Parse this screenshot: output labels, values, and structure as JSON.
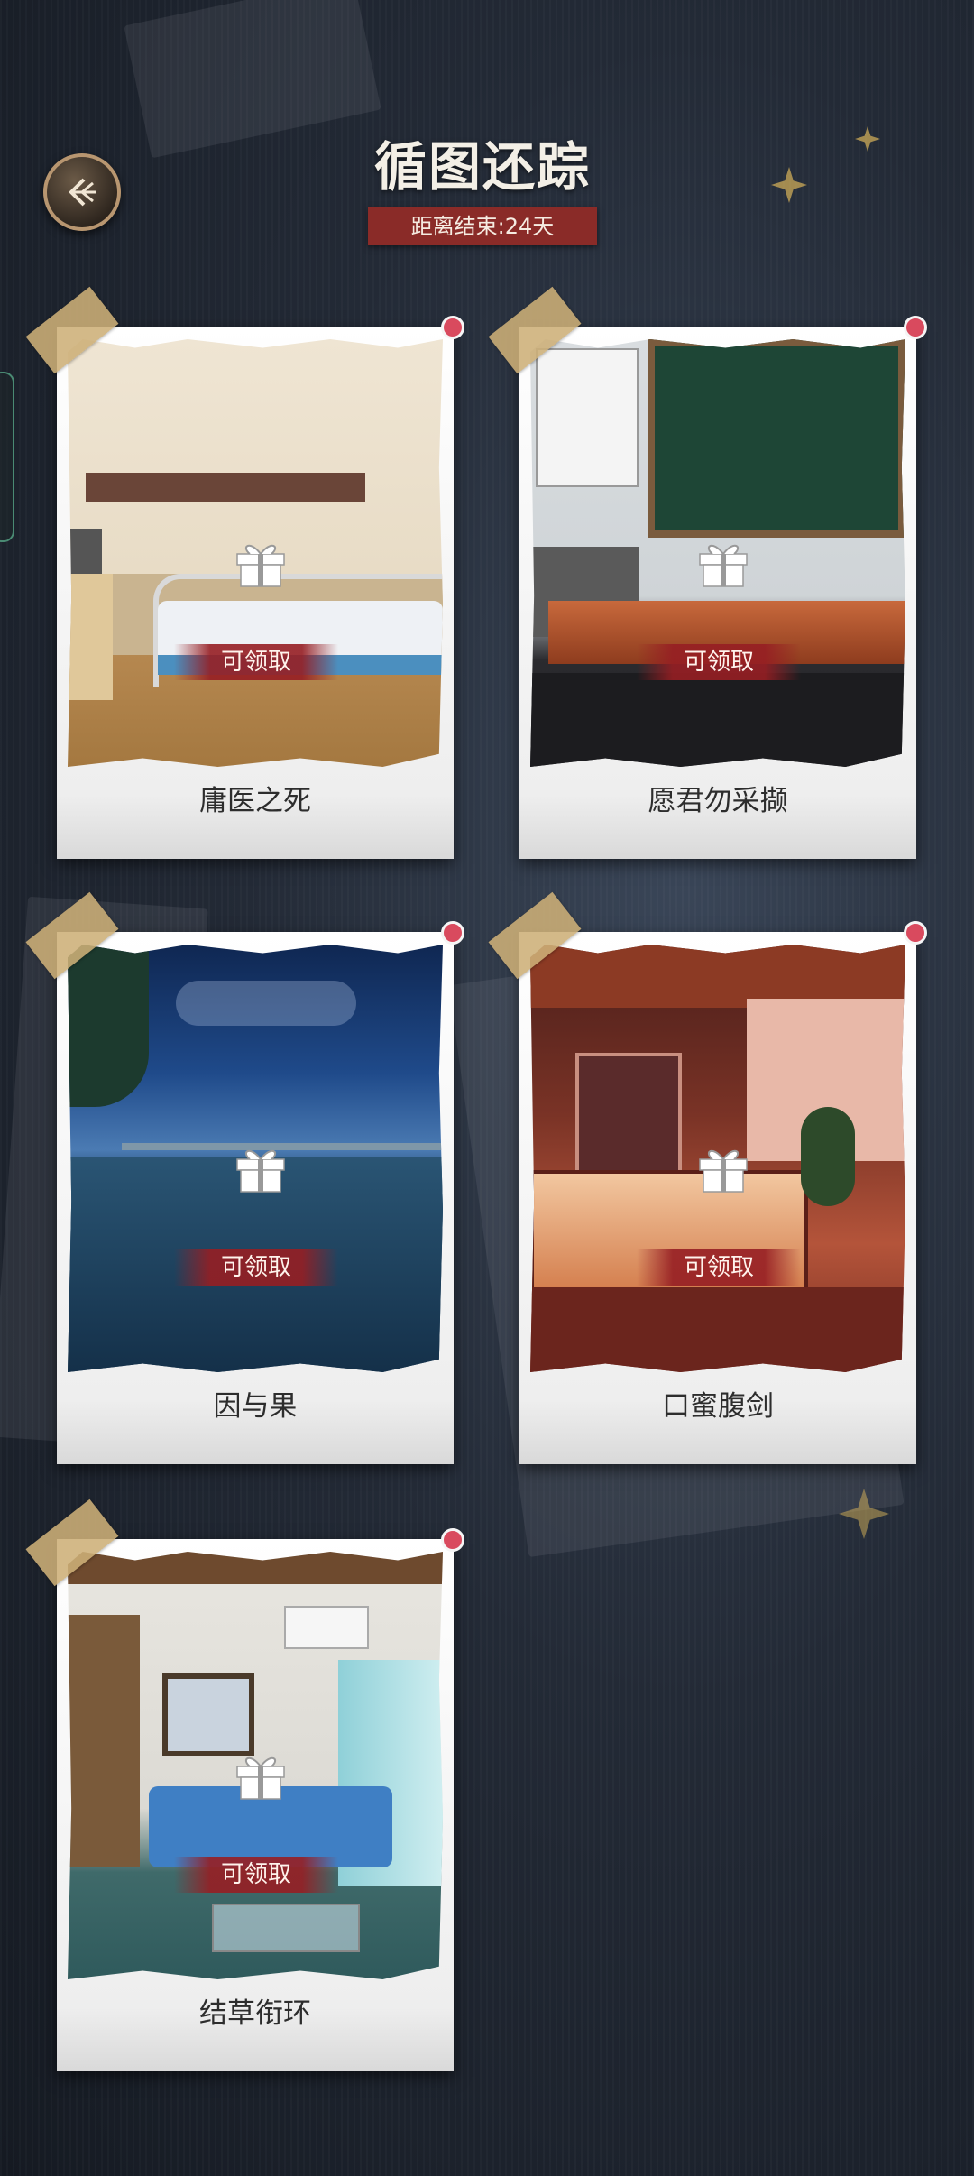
{
  "header": {
    "title": "循图还踪",
    "countdown": "距离结束:24天"
  },
  "icons": {
    "back": "back-arrow-icon",
    "gift": "gift-icon"
  },
  "colors": {
    "accent_red": "#8a2b28",
    "badge": "#d94a5e",
    "tape": "#cdaf78"
  },
  "cards": [
    {
      "title": "庸医之死",
      "claim_label": "可领取",
      "scene": "hospital-room",
      "has_badge": true
    },
    {
      "title": "愿君勿采撷",
      "claim_label": "可领取",
      "scene": "classroom",
      "has_badge": true
    },
    {
      "title": "因与果",
      "claim_label": "可领取",
      "scene": "night-rooftop",
      "has_badge": true
    },
    {
      "title": "口蜜腹剑",
      "claim_label": "可领取",
      "scene": "bakery",
      "has_badge": true
    },
    {
      "title": "结草衔环",
      "claim_label": "可领取",
      "scene": "bedroom",
      "has_badge": true
    }
  ]
}
